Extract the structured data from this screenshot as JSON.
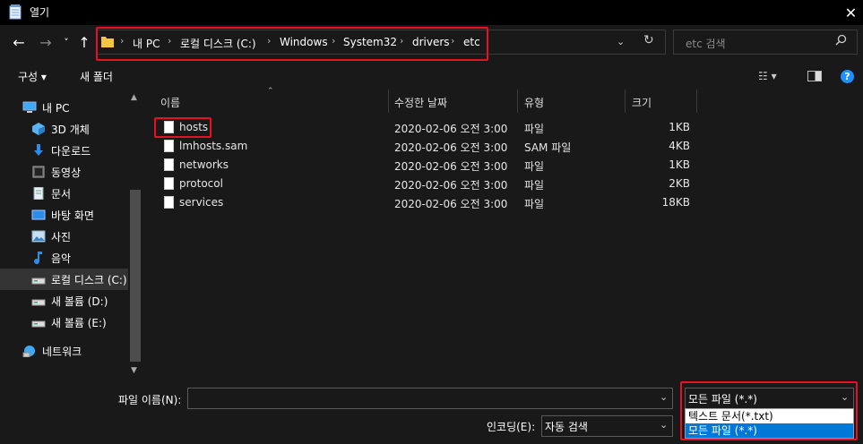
{
  "window": {
    "title": "열기",
    "close_glyph": "✕"
  },
  "nav_buttons": {
    "back": "←",
    "forward": "→",
    "recent": "˅",
    "up": "↑"
  },
  "breadcrumb": [
    "내 PC",
    "로컬 디스크 (C:)",
    "Windows",
    "System32",
    "drivers",
    "etc"
  ],
  "breadcrumb_sep": "›",
  "search": {
    "placeholder": "etc 검색"
  },
  "toolbar": {
    "organize": "구성 ▾",
    "new_folder": "새 폴더",
    "view": "☷ ▾",
    "help": "?"
  },
  "nav_pane": [
    {
      "label": "내 PC",
      "icon": "pc-icon"
    },
    {
      "label": "3D 개체",
      "icon": "cube-icon"
    },
    {
      "label": "다운로드",
      "icon": "download-icon"
    },
    {
      "label": "동영상",
      "icon": "video-icon"
    },
    {
      "label": "문서",
      "icon": "document-icon"
    },
    {
      "label": "바탕 화면",
      "icon": "desktop-icon"
    },
    {
      "label": "사진",
      "icon": "picture-icon"
    },
    {
      "label": "음악",
      "icon": "music-icon"
    },
    {
      "label": "로컬 디스크 (C:)",
      "icon": "drive-icon"
    },
    {
      "label": "새 볼륨 (D:)",
      "icon": "drive-icon"
    },
    {
      "label": "새 볼륨 (E:)",
      "icon": "drive-icon"
    },
    {
      "label": "네트워크",
      "icon": "network-icon"
    }
  ],
  "columns": {
    "name": "이름",
    "modified": "수정한 날짜",
    "type": "유형",
    "size": "크기"
  },
  "files": [
    {
      "name": "hosts",
      "modified": "2020-02-06 오전 3:00",
      "type": "파일",
      "size": "1KB"
    },
    {
      "name": "lmhosts.sam",
      "modified": "2020-02-06 오전 3:00",
      "type": "SAM 파일",
      "size": "4KB"
    },
    {
      "name": "networks",
      "modified": "2020-02-06 오전 3:00",
      "type": "파일",
      "size": "1KB"
    },
    {
      "name": "protocol",
      "modified": "2020-02-06 오전 3:00",
      "type": "파일",
      "size": "2KB"
    },
    {
      "name": "services",
      "modified": "2020-02-06 오전 3:00",
      "type": "파일",
      "size": "18KB"
    }
  ],
  "bottom": {
    "filename_label": "파일 이름(N):",
    "filename_value": "",
    "encoding_label": "인코딩(E):",
    "encoding_value": "자동 검색",
    "type_value": "모든 파일 (*.*)",
    "type_options": [
      "텍스트 문서(*.txt)",
      "모든 파일 (*.*)"
    ]
  },
  "colors": {
    "highlight_red": "#e81123",
    "selection_blue": "#0078d7",
    "background": "#191919"
  }
}
